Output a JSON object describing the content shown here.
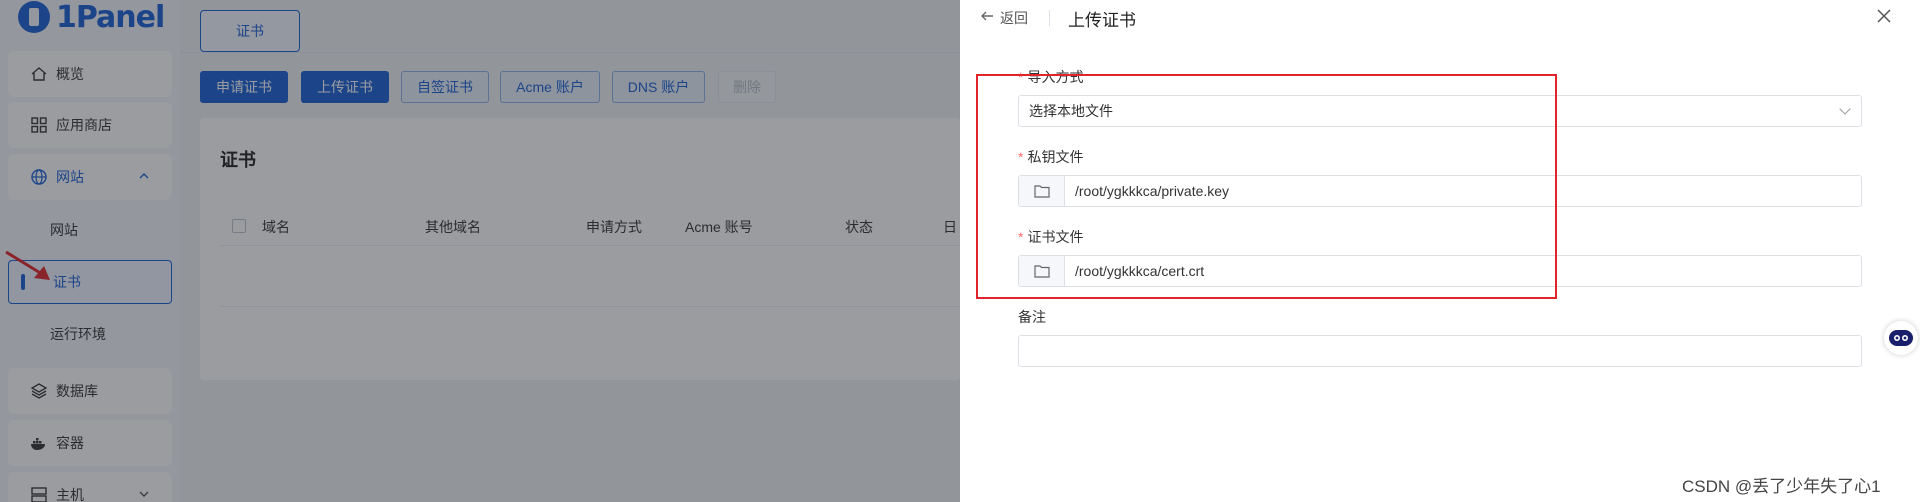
{
  "sidebar": {
    "logo_text": "1Panel",
    "items": [
      {
        "label": "概览",
        "icon": "home-icon"
      },
      {
        "label": "应用商店",
        "icon": "grid-icon"
      },
      {
        "label": "网站",
        "icon": "globe-icon",
        "expanded": true
      }
    ],
    "sub_items": [
      {
        "label": "网站"
      },
      {
        "label": "证书",
        "active": true
      },
      {
        "label": "运行环境"
      }
    ],
    "lower_items": [
      {
        "label": "数据库",
        "icon": "layers-icon"
      },
      {
        "label": "容器",
        "icon": "docker-icon"
      },
      {
        "label": "主机",
        "icon": "server-icon"
      }
    ]
  },
  "main": {
    "top_tab": "证书",
    "buttons": {
      "apply": "申请证书",
      "upload": "上传证书",
      "self_signed": "自签证书",
      "acme": "Acme 账户",
      "dns": "DNS 账户",
      "delete": "删除"
    },
    "card_title": "证书",
    "columns": [
      "域名",
      "其他域名",
      "申请方式",
      "Acme 账号",
      "状态",
      "日"
    ]
  },
  "drawer": {
    "back_label": "返回",
    "title": "上传证书",
    "import_method": {
      "label": "导入方式",
      "value": "选择本地文件"
    },
    "private_key": {
      "label": "私钥文件",
      "value": "/root/ygkkkca/private.key"
    },
    "cert_file": {
      "label": "证书文件",
      "value": "/root/ygkkkca/cert.crt"
    },
    "remark": {
      "label": "备注",
      "value": ""
    }
  },
  "watermark": "CSDN @丢了少年失了心1",
  "colors": {
    "primary": "#1a5fd6",
    "required": "#f56c6c",
    "annotation": "#e0262b"
  }
}
